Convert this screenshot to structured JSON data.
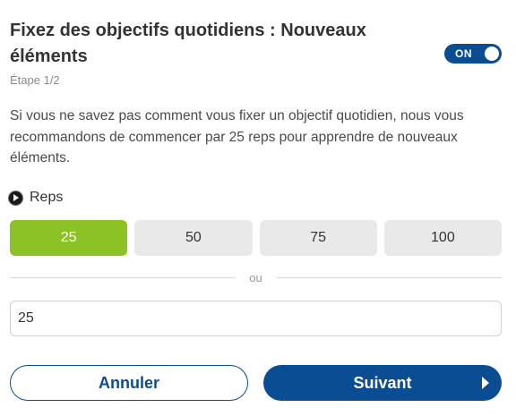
{
  "header": {
    "title": "Fixez des objectifs quotidiens : Nouveaux éléments",
    "toggle_label": "ON",
    "step": "Étape 1/2"
  },
  "description": "Si vous ne savez pas comment vous fixer un objectif quotidien, nous vous recommandons de commencer par 25 reps pour apprendre de nouveaux éléments.",
  "reps": {
    "label": "Reps",
    "options": [
      "25",
      "50",
      "75",
      "100"
    ],
    "selected": "25"
  },
  "divider_text": "ou",
  "custom_input": {
    "value": "25"
  },
  "actions": {
    "cancel_label": "Annuler",
    "next_label": "Suivant"
  },
  "colors": {
    "primary": "#0b4d93",
    "selected_option": "#8cc225",
    "option_bg": "#e9e9e9"
  }
}
